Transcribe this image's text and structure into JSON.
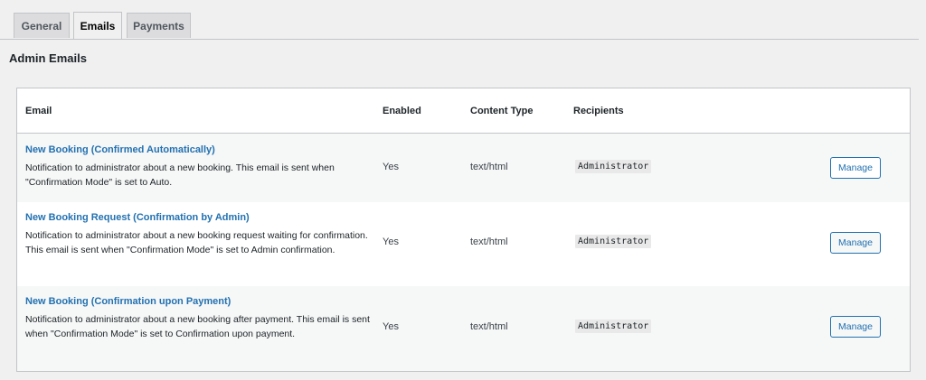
{
  "tabs": [
    {
      "label": "General"
    },
    {
      "label": "Emails",
      "active": true
    },
    {
      "label": "Payments"
    }
  ],
  "section": {
    "title": "Admin Emails"
  },
  "table": {
    "headers": {
      "email": "Email",
      "enabled": "Enabled",
      "content_type": "Content Type",
      "recipients": "Recipients"
    },
    "rows": [
      {
        "title": "New Booking (Confirmed Automatically)",
        "description": "Notification to administrator about a new booking. This email is sent when \"Confirmation Mode\" is set to Auto.",
        "enabled": "Yes",
        "content_type": "text/html",
        "recipients": "Administrator",
        "action": "Manage"
      },
      {
        "title": "New Booking Request (Confirmation by Admin)",
        "description": "Notification to administrator about a new booking request waiting for confirmation. This email is sent when \"Confirmation Mode\" is set to Admin confirmation.",
        "enabled": "Yes",
        "content_type": "text/html",
        "recipients": "Administrator",
        "action": "Manage"
      },
      {
        "title": "New Booking (Confirmation upon Payment)",
        "description": "Notification to administrator about a new booking after payment. This email is sent when \"Confirmation Mode\" is set to Confirmation upon payment.",
        "enabled": "Yes",
        "content_type": "text/html",
        "recipients": "Administrator",
        "action": "Manage"
      }
    ]
  },
  "colors": {
    "link": "#2271b1",
    "background": "#f0f0f1",
    "border": "#c3c4c7"
  }
}
